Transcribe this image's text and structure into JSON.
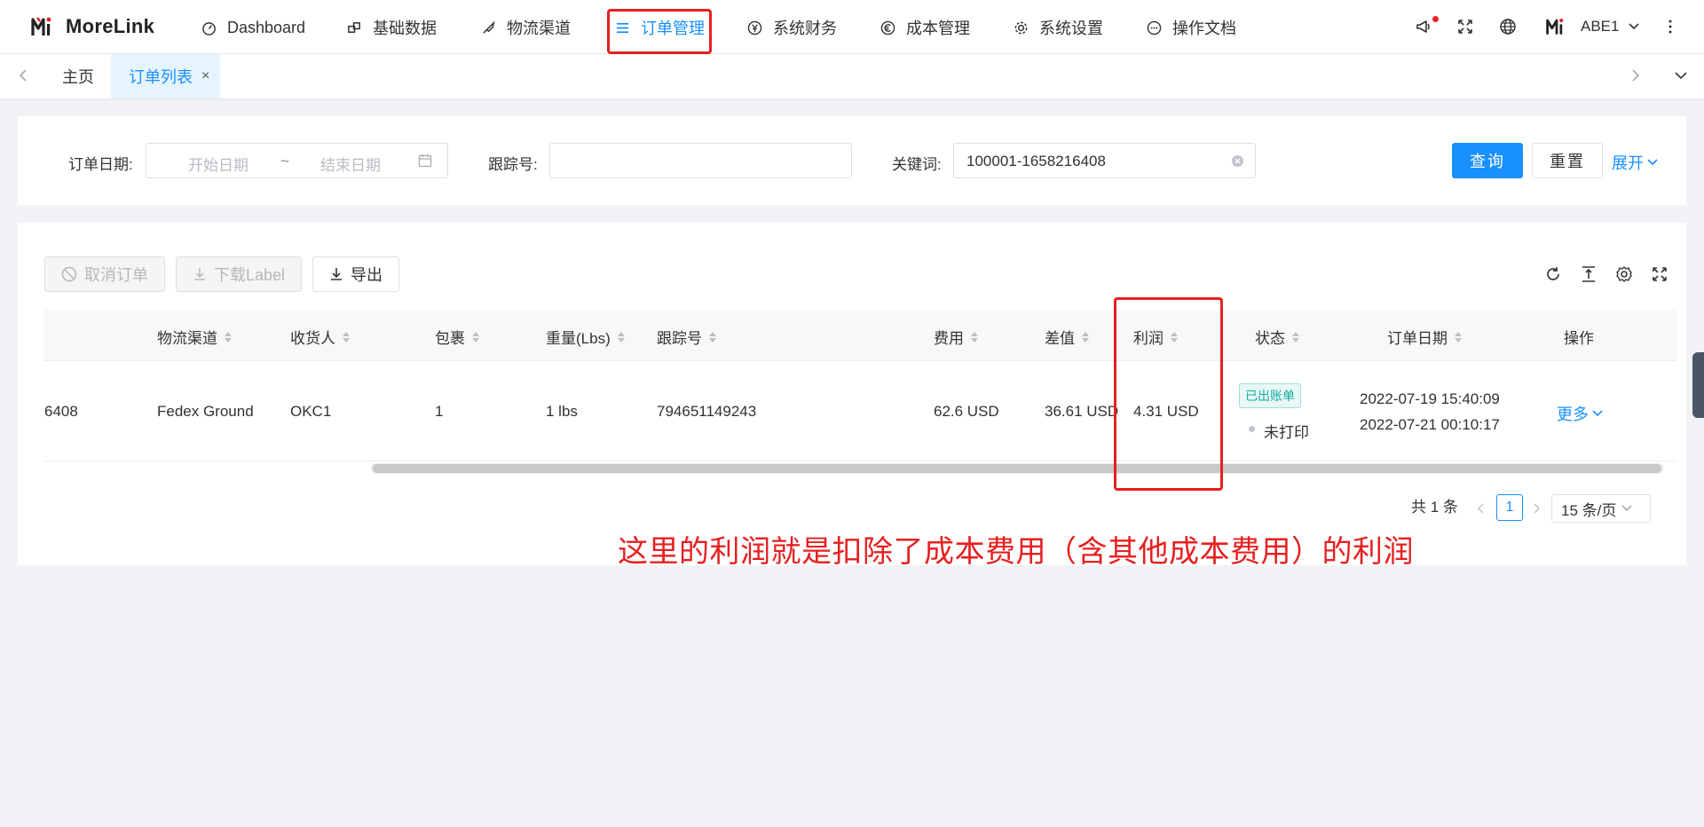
{
  "app": {
    "name": "MoreLink"
  },
  "nav": [
    {
      "label": "Dashboard",
      "icon": "dashboard-icon"
    },
    {
      "label": "基础数据",
      "icon": "cube-icon"
    },
    {
      "label": "物流渠道",
      "icon": "rocket-icon"
    },
    {
      "label": "订单管理",
      "icon": "list-icon",
      "active": true
    },
    {
      "label": "系统财务",
      "icon": "yen-icon"
    },
    {
      "label": "成本管理",
      "icon": "euro-icon"
    },
    {
      "label": "系统设置",
      "icon": "gear-icon"
    },
    {
      "label": "操作文档",
      "icon": "chat-icon"
    }
  ],
  "user": {
    "name": "ABE1"
  },
  "tabs": [
    {
      "label": "主页"
    },
    {
      "label": "订单列表",
      "active": true,
      "close": "×"
    }
  ],
  "search": {
    "order_date_label": "订单日期:",
    "start_placeholder": "开始日期",
    "range_sep": "~",
    "end_placeholder": "结束日期",
    "tracking_label": "跟踪号:",
    "tracking_value": "",
    "keyword_label": "关键词:",
    "keyword_value": "100001-1658216408",
    "query_button": "查询",
    "reset_button": "重置",
    "expand_link": "展开"
  },
  "toolbar": {
    "cancel_order": "取消订单",
    "download_label": "下载Label",
    "export": "导出"
  },
  "table": {
    "columns": [
      "物流渠道",
      "收货人",
      "包裹",
      "重量(Lbs)",
      "跟踪号",
      "费用",
      "差值",
      "利润",
      "状态",
      "订单日期",
      "操作"
    ],
    "rows": [
      {
        "order_no_partial": "6408",
        "channel": "Fedex Ground",
        "receiver": "OKC1",
        "packages": "1",
        "weight": "1 lbs",
        "tracking": "794651149243",
        "fee": "62.6 USD",
        "diff": "36.61 USD",
        "profit": "4.31 USD",
        "status_badge": "已出账单",
        "print_status": "未打印",
        "created": "2022-07-19 15:40:09",
        "updated": "2022-07-21 00:10:17",
        "action": "更多"
      }
    ]
  },
  "pagination": {
    "total": "共 1 条",
    "current": "1",
    "page_size": "15 条/页"
  },
  "annotation": "这里的利润就是扣除了成本费用（含其他成本费用）的利润",
  "colors": {
    "primary": "#1890ff",
    "annotation": "#e62020",
    "badge": "#13a89e"
  }
}
